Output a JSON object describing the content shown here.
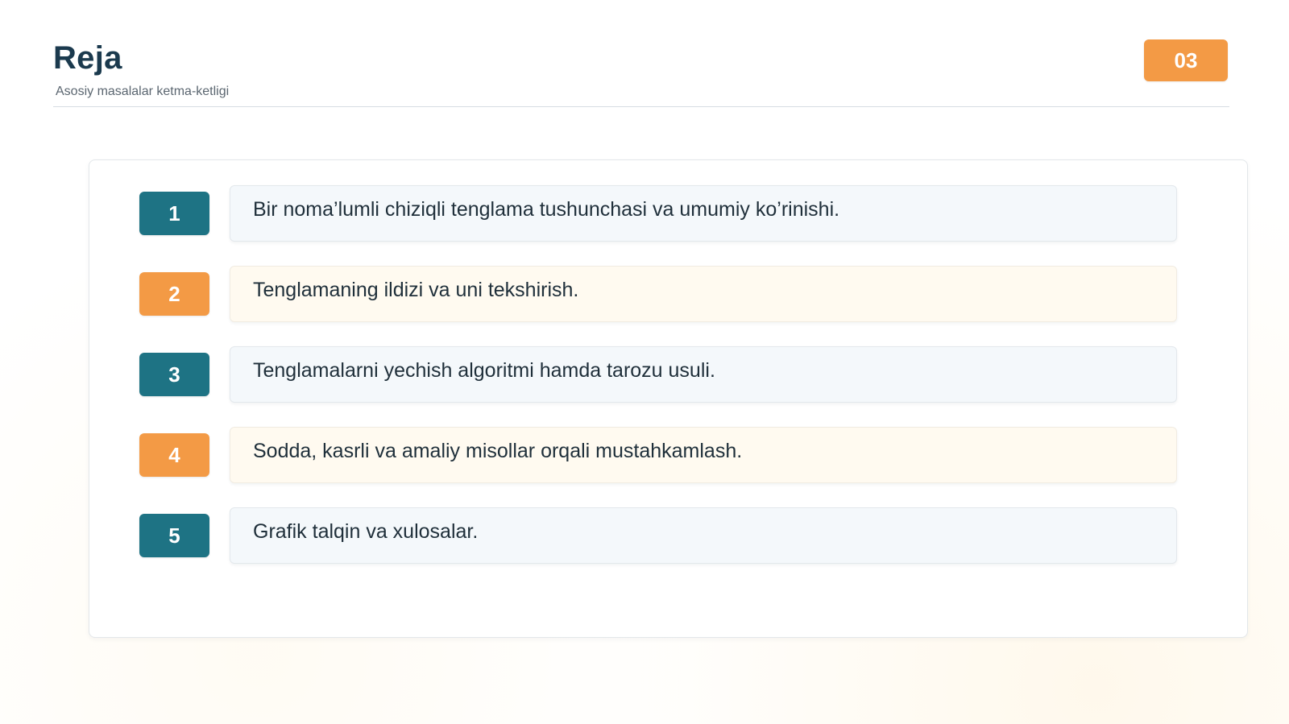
{
  "header": {
    "title": "Reja",
    "subtitle": "Asosiy masalalar ketma-ketligi",
    "page_number": "03"
  },
  "colors": {
    "teal": "#1e7384",
    "orange": "#f39a45",
    "title": "#1b3a4e"
  },
  "items": [
    {
      "number": "1",
      "text": "Bir noma’lumli chiziqli tenglama tushunchasi va umumiy ko’rinishi.",
      "accent": "teal"
    },
    {
      "number": "2",
      "text": "Tenglamaning ildizi va uni tekshirish.",
      "accent": "orange"
    },
    {
      "number": "3",
      "text": "Tenglamalarni yechish algoritmi hamda tarozu usuli.",
      "accent": "teal"
    },
    {
      "number": "4",
      "text": "Sodda, kasrli va amaliy misollar orqali mustahkamlash.",
      "accent": "orange"
    },
    {
      "number": "5",
      "text": "Grafik talqin va xulosalar.",
      "accent": "teal"
    }
  ]
}
